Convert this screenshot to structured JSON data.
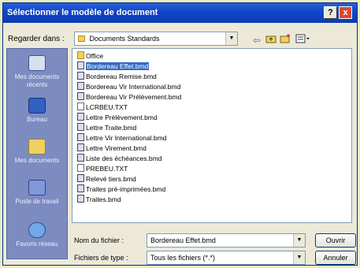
{
  "window": {
    "title": "Sélectionner le modèle de document",
    "help_label": "?",
    "close_label": "x"
  },
  "toolbar": {
    "look_in_label": "Regarder dans :",
    "look_in_value": "Documents Standards"
  },
  "places": [
    {
      "label": "Mes documents récents",
      "icon": "recent-documents-icon"
    },
    {
      "label": "Bureau",
      "icon": "desktop-icon"
    },
    {
      "label": "Mes documents",
      "icon": "my-documents-icon"
    },
    {
      "label": "Poste de travail",
      "icon": "my-computer-icon"
    },
    {
      "label": "Favoris réseau",
      "icon": "network-places-icon"
    }
  ],
  "files": [
    {
      "name": "Office",
      "type": "folder"
    },
    {
      "name": "Bordereau Effet.bmd",
      "type": "bmd",
      "selected": true
    },
    {
      "name": "Bordereau Remise.bmd",
      "type": "bmd"
    },
    {
      "name": "Bordereau Vir International.bmd",
      "type": "bmd"
    },
    {
      "name": "Bordereau Vir Prélèvement.bmd",
      "type": "bmd"
    },
    {
      "name": "LCRBEU.TXT",
      "type": "txt"
    },
    {
      "name": "Lettre Prélèvement.bmd",
      "type": "bmd"
    },
    {
      "name": "Lettre Traite.bmd",
      "type": "bmd"
    },
    {
      "name": "Lettre Vir International.bmd",
      "type": "bmd"
    },
    {
      "name": "Lettre Virement.bmd",
      "type": "bmd"
    },
    {
      "name": "Liste des échéances.bmd",
      "type": "bmd"
    },
    {
      "name": "PREBEU.TXT",
      "type": "txt"
    },
    {
      "name": "Relevé tiers.bmd",
      "type": "bmd"
    },
    {
      "name": "Traites pré-imprimées.bmd",
      "type": "bmd"
    },
    {
      "name": "Traites.bmd",
      "type": "bmd"
    }
  ],
  "form": {
    "filename_label": "Nom du fichier :",
    "filename_value": "Bordereau Effet.bmd",
    "filetype_label": "Fichiers de type :",
    "filetype_value": "Tous les fichiers (*.*)"
  },
  "buttons": {
    "open_label": "Ouvrir",
    "cancel_label": "Annuler"
  }
}
